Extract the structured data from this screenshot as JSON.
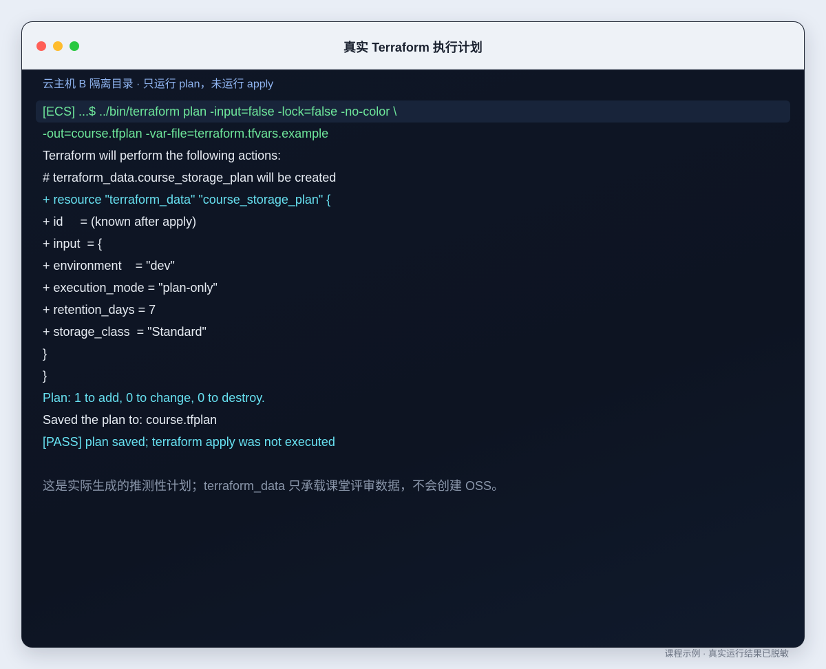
{
  "window": {
    "title": "真实 Terraform 执行计划",
    "subtitle": "云主机 B 隔离目录 · 只运行 plan，未运行 apply"
  },
  "terminal": {
    "lines": [
      {
        "text": "[ECS] ...$ ../bin/terraform plan -input=false -lock=false -no-color \\",
        "kind": "cmd"
      },
      {
        "text": "-out=course.tfplan -var-file=terraform.tfvars.example",
        "kind": "cmd"
      },
      {
        "text": "Terraform will perform the following actions:",
        "kind": "normal"
      },
      {
        "text": "# terraform_data.course_storage_plan will be created",
        "kind": "normal"
      },
      {
        "text": "+ resource \"terraform_data\" \"course_storage_plan\" {",
        "kind": "add"
      },
      {
        "text": "+ id     = (known after apply)",
        "kind": "normal"
      },
      {
        "text": "+ input  = {",
        "kind": "normal"
      },
      {
        "text": "+ environment    = \"dev\"",
        "kind": "normal"
      },
      {
        "text": "+ execution_mode = \"plan-only\"",
        "kind": "normal"
      },
      {
        "text": "+ retention_days = 7",
        "kind": "normal"
      },
      {
        "text": "+ storage_class  = \"Standard\"",
        "kind": "normal"
      },
      {
        "text": "}",
        "kind": "normal"
      },
      {
        "text": "}",
        "kind": "normal"
      },
      {
        "text": "Plan: 1 to add, 0 to change, 0 to destroy.",
        "kind": "add"
      },
      {
        "text": "Saved the plan to: course.tfplan",
        "kind": "normal"
      },
      {
        "text": "[PASS] plan saved; terraform apply was not executed",
        "kind": "pass"
      }
    ],
    "note": "这是实际生成的推测性计划；terraform_data 只承载课堂评审数据，不会创建 OSS。"
  },
  "footer": "课程示例 · 真实运行结果已脱敏",
  "colors": {
    "command": "#6ee79b",
    "add": "#67e0f0",
    "normal": "#e6ebf2",
    "subtitle": "#8fb4f0",
    "note": "#8a96aa"
  }
}
